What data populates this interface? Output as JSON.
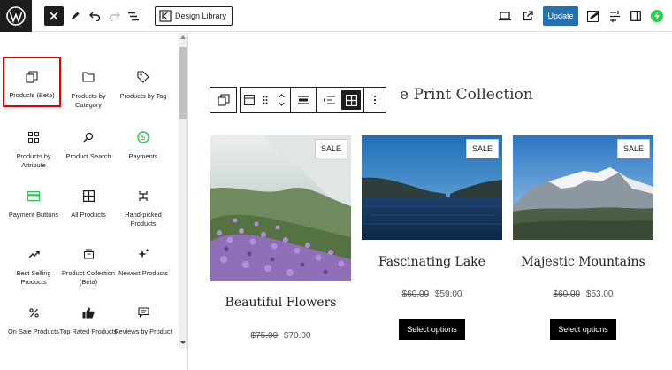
{
  "topbar": {
    "design_library_label": "Design Library",
    "update_label": "Update"
  },
  "sidebar": {
    "blocks": [
      {
        "label": "Products (Beta)",
        "icon": "copy-icon"
      },
      {
        "label": "Products by Category",
        "icon": "folder-icon"
      },
      {
        "label": "Products by Tag",
        "icon": "tag-icon"
      },
      {
        "label": "Products by Attribute",
        "icon": "grid-dots-icon"
      },
      {
        "label": "Product Search",
        "icon": "search-icon"
      },
      {
        "label": "Payments",
        "icon": "dollar-circle-icon"
      },
      {
        "label": "Payment Buttons",
        "icon": "card-icon"
      },
      {
        "label": "All Products",
        "icon": "grid-icon"
      },
      {
        "label": "Hand-picked Products",
        "icon": "hand-picked-icon"
      },
      {
        "label": "Best Selling Products",
        "icon": "trending-icon"
      },
      {
        "label": "Product Collection (Beta)",
        "icon": "collection-icon"
      },
      {
        "label": "Newest Products",
        "icon": "sparkle-icon"
      },
      {
        "label": "On Sale Products",
        "icon": "percent-icon"
      },
      {
        "label": "Top Rated Products",
        "icon": "thumbs-up-icon"
      },
      {
        "label": "Reviews by Product",
        "icon": "comment-icon"
      }
    ]
  },
  "canvas": {
    "heading": "e Print Collection",
    "products": [
      {
        "name": "Beautiful Flowers",
        "sale_badge": "SALE",
        "old_price": "$75.00",
        "new_price": "$70.00"
      },
      {
        "name": "Fascinating Lake",
        "sale_badge": "SALE",
        "old_price": "$60.00",
        "new_price": "$59.00",
        "button": "Select options"
      },
      {
        "name": "Majestic Mountains",
        "sale_badge": "SALE",
        "old_price": "$60.00",
        "new_price": "$53.00",
        "button": "Select options"
      }
    ]
  },
  "colors": {
    "accent": "#2271b1",
    "selection": "#e00000",
    "wc_green": "#1ed14b"
  }
}
